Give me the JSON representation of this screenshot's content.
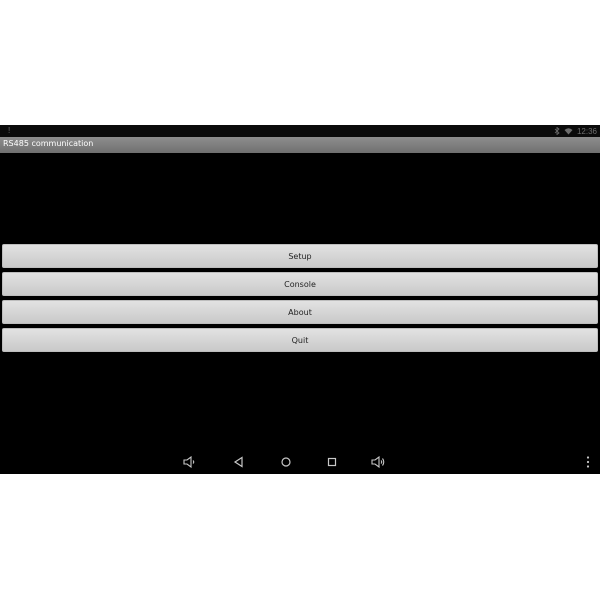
{
  "status_bar": {
    "left_indicator": "!",
    "time": "12:36",
    "icons": [
      "bluetooth-icon",
      "wifi-icon"
    ]
  },
  "app": {
    "title": "RS485 communication"
  },
  "menu": {
    "buttons": [
      {
        "label": "Setup"
      },
      {
        "label": "Console"
      },
      {
        "label": "About"
      },
      {
        "label": "Quit"
      }
    ]
  },
  "nav_bar": {
    "icons": [
      "volume-down-icon",
      "back-icon",
      "home-icon",
      "recent-apps-icon",
      "volume-up-icon",
      "overflow-menu-icon"
    ]
  },
  "colors": {
    "screen_background": "#000000",
    "title_bar": "#7f7f7f",
    "button_face": "#d6d6d6",
    "nav_icon": "#c8c8c8"
  }
}
